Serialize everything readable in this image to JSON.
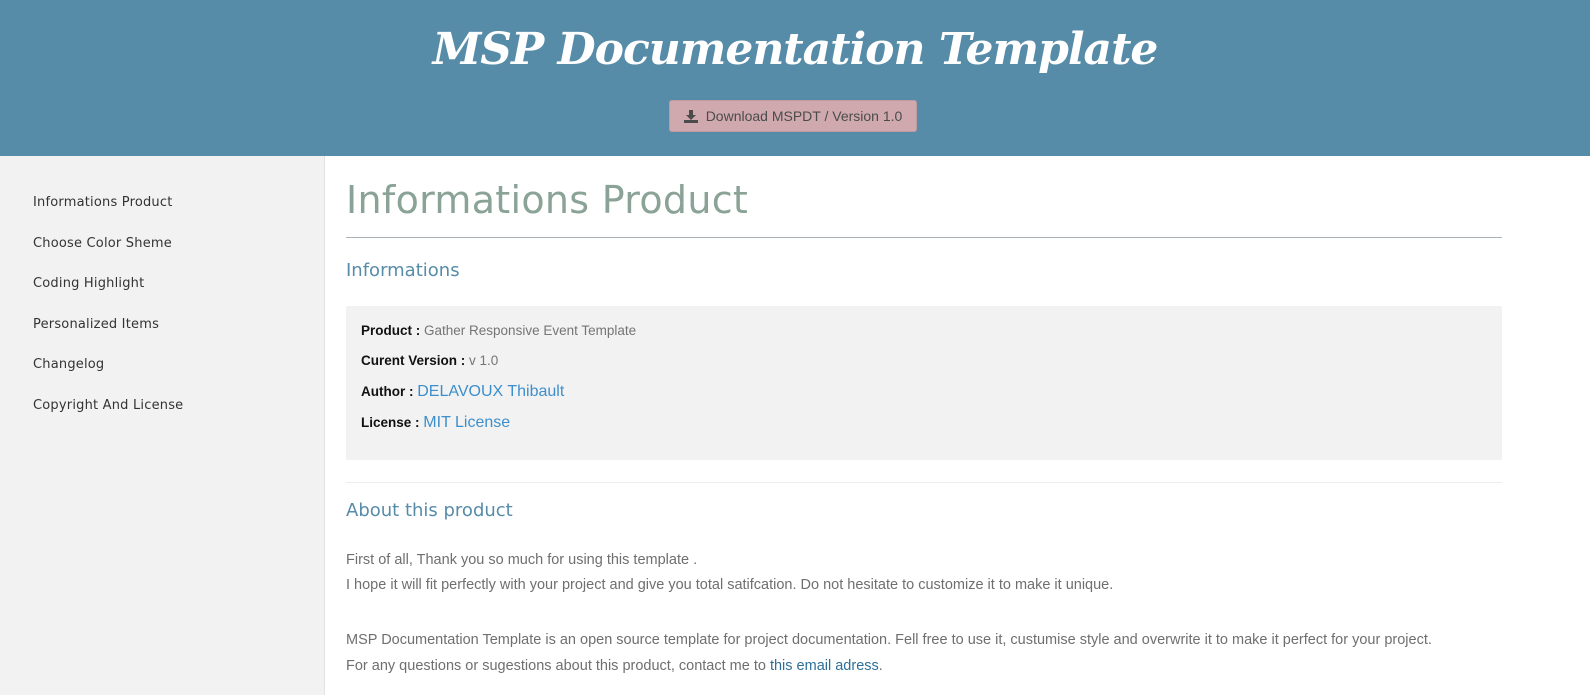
{
  "header": {
    "title": "MSP Documentation Template",
    "download_label": "Download MSPDT / Version 1.0",
    "bg_color": "#578ca9",
    "button_color": "#d0a9ae"
  },
  "sidebar": {
    "items": [
      {
        "label": "Informations Product"
      },
      {
        "label": "Choose Color Sheme"
      },
      {
        "label": "Coding Highlight"
      },
      {
        "label": "Personalized Items"
      },
      {
        "label": "Changelog"
      },
      {
        "label": "Copyright And License"
      }
    ]
  },
  "main": {
    "page_title": "Informations Product",
    "informations": {
      "heading": "Informations",
      "rows": [
        {
          "key": "Product :",
          "value": "Gather Responsive Event Template"
        },
        {
          "key": "Curent Version :",
          "value": "v 1.0"
        },
        {
          "key": "Author :",
          "link": "DELAVOUX Thibault"
        },
        {
          "key": "License :",
          "link": "MIT License"
        }
      ]
    },
    "about": {
      "heading": "About this product",
      "line1": "First of all, Thank you so much for using this template .",
      "line2": "I hope it will fit perfectly with your project and give you total satifcation. Do not hesitate to customize it to make it unique.",
      "line3": "MSP Documentation Template is an open source template for project documentation. Fell free to use it, custumise style and overwrite it to make it perfect for your project.",
      "line4_prefix": "For any questions or sugestions about this product, contact me to",
      "line4_link": "this email adress",
      "line4_suffix": "."
    }
  }
}
